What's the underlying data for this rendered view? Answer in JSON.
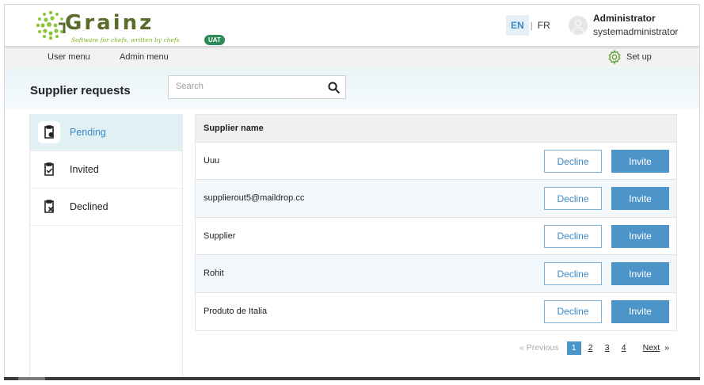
{
  "header": {
    "logo_text": "Grainz",
    "logo_tagline": "Software for chefs, written by chefs",
    "env_badge": "UAT",
    "lang_en": "EN",
    "lang_sep": "|",
    "lang_fr": "FR",
    "user_name": "Administrator",
    "user_login": "systemadministrator"
  },
  "menu": {
    "user_menu": "User menu",
    "admin_menu": "Admin menu",
    "setup": "Set up"
  },
  "page": {
    "title": "Supplier requests",
    "search_placeholder": "Search"
  },
  "sidebar": {
    "items": [
      {
        "label": "Pending",
        "icon": "clipboard-clock-icon",
        "active": true
      },
      {
        "label": "Invited",
        "icon": "clipboard-check-icon",
        "active": false
      },
      {
        "label": "Declined",
        "icon": "clipboard-x-icon",
        "active": false
      }
    ]
  },
  "table": {
    "column_header": "Supplier name",
    "decline_label": "Decline",
    "invite_label": "Invite",
    "rows": [
      {
        "name": "Uuu"
      },
      {
        "name": "supplierout5@maildrop.cc"
      },
      {
        "name": "Supplier"
      },
      {
        "name": "Rohit"
      },
      {
        "name": "Produto de Italia"
      }
    ]
  },
  "pagination": {
    "prev": "« Previous",
    "pages": [
      "1",
      "2",
      "3",
      "4"
    ],
    "current": "1",
    "next": "Next",
    "next_arrow": "»"
  },
  "colors": {
    "accent": "#4d95c9",
    "brand_green": "#7ab51d",
    "badge_green": "#2e8b57"
  }
}
